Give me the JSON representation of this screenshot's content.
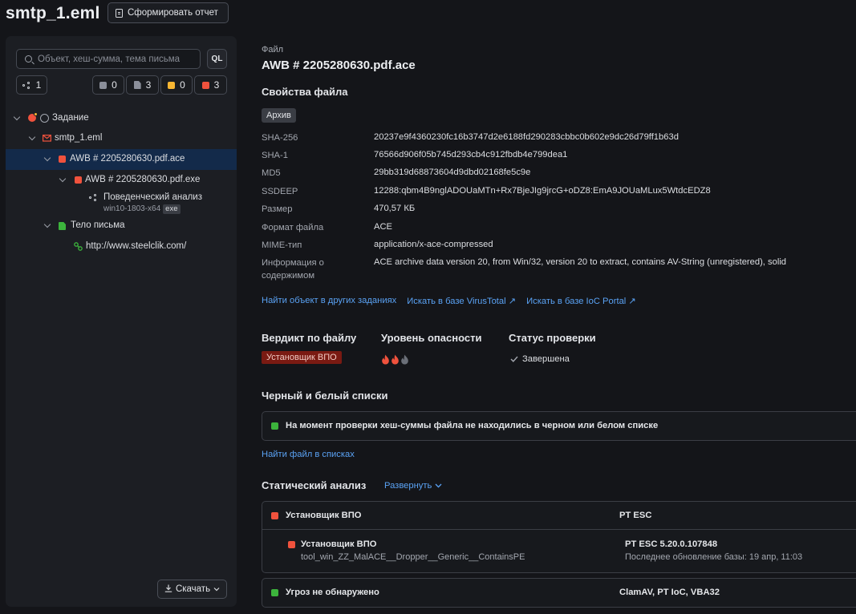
{
  "header": {
    "title": "smtp_1.eml",
    "report_button": "Сформировать отчет"
  },
  "sidebar": {
    "search_placeholder": "Объект, хеш-сумма, тема письма",
    "ql_label": "QL",
    "counters": {
      "graph": "1",
      "grey": "0",
      "doc": "3",
      "orange": "0",
      "red": "3"
    },
    "tree": [
      {
        "label": "Задание"
      },
      {
        "label": "smtp_1.eml"
      },
      {
        "label": "AWB # 2205280630.pdf.ace"
      },
      {
        "label": "AWB # 2205280630.pdf.exe"
      },
      {
        "label": "Поведенческий анализ",
        "sub": "win10-1803-x64",
        "badge": "exe"
      },
      {
        "label": "Тело письма"
      },
      {
        "label": "http://www.steelclik.com/"
      }
    ],
    "download_button": "Скачать"
  },
  "main": {
    "file_label": "Файл",
    "file_name": "AWB # 2205280630.pdf.ace",
    "props_title": "Свойства файла",
    "archive_tag": "Архив",
    "props": [
      {
        "k": "SHA-256",
        "v": "20237e9f4360230fc16b3747d2e6188fd290283cbbc0b602e9dc26d79ff1b63d"
      },
      {
        "k": "SHA-1",
        "v": "76566d906f05b745d293cb4c912fbdb4e799dea1"
      },
      {
        "k": "MD5",
        "v": "29bb319d68873604d9dbd02168fe5c9e"
      },
      {
        "k": "SSDEEP",
        "v": "12288:qbm4B9nglADOUaMTn+Rx7BjeJIg9jrcG+oDZ8:EmA9JOUaMLux5WtdcEDZ8"
      },
      {
        "k": "Размер",
        "v": "470,57 КБ"
      },
      {
        "k": "Формат файла",
        "v": "ACE"
      },
      {
        "k": "MIME-тип",
        "v": "application/x-ace-compressed"
      },
      {
        "k": "Информация о содержимом",
        "v": "ACE archive data version 20, from Win/32, version 20 to extract, contains AV-String (unregistered), solid"
      }
    ],
    "links": [
      "Найти объект в других заданиях",
      "Искать в базе VirusTotal ↗",
      "Искать в базе IoC Portal ↗"
    ],
    "verdict_title": "Вердикт по файлу",
    "verdict_value": "Установщик ВПО",
    "danger_title": "Уровень опасности",
    "danger_level": {
      "filled": 2,
      "total": 3
    },
    "status_title": "Статус проверки",
    "status_value": "Завершена",
    "bw_title": "Черный и белый списки",
    "bw_text": "На момент проверки хеш-суммы файла не находились в черном или белом списке",
    "bw_link": "Найти файл в списках",
    "static_title": "Статический анализ",
    "static_expand": "Развернуть",
    "static_rows": [
      {
        "verdict": "Установщик ВПО",
        "engine": "PT ESC"
      },
      {
        "verdict": "Установщик ВПО",
        "detail": "tool_win_ZZ_MalACE__Dropper__Generic__ContainsPE",
        "engine": "PT ESC 5.20.0.107848",
        "engine_detail": "Последнее обновление базы: 19 апр, 11:03"
      },
      {
        "verdict": "Угроз не обнаружено",
        "engine": "ClamAV, PT IoC, VBA32"
      }
    ]
  },
  "colors": {
    "accent": "#5aa2f4",
    "danger": "#f0523d",
    "warning": "#f7b632",
    "safe": "#3cb43c",
    "selected": "#132a4a"
  }
}
